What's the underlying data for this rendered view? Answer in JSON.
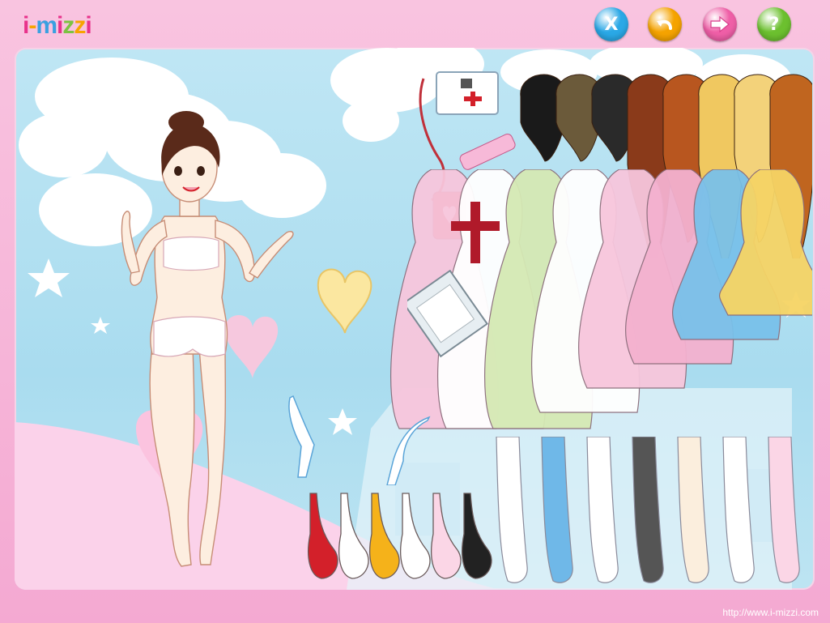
{
  "header": {
    "logo_text": "i-mizzi",
    "logo_letters": [
      "i",
      "-",
      "m",
      "i",
      "z",
      "z",
      "i"
    ],
    "logo_colors": [
      "#e8328b",
      "#f7a400",
      "#3aa0e0",
      "#e8328b",
      "#7cc242",
      "#f7a400",
      "#e8328b"
    ]
  },
  "toolbar": {
    "buttons": [
      {
        "id": "close",
        "glyph": "X",
        "icon": "x-icon",
        "color": "#2aa8e6"
      },
      {
        "id": "undo",
        "glyph": "↶",
        "icon": "undo-icon",
        "color": "#f5a300"
      },
      {
        "id": "next",
        "glyph": "⇨",
        "icon": "arrow-right-icon",
        "color": "#ef5fa7"
      },
      {
        "id": "help",
        "glyph": "?",
        "icon": "question-icon",
        "color": "#6cc02f"
      }
    ]
  },
  "footer": {
    "url": "http://www.i-mizzi.com"
  },
  "colors": {
    "sky": "#b8e3f3",
    "cloud": "#ffffff",
    "ground_pink": "#fbd2ea",
    "skin": "#fdeee0",
    "nurse_red": "#d3202a"
  },
  "wardrobe": {
    "hair_colors": [
      "#1a1a1a",
      "#6b5a3a",
      "#2a2a2a",
      "#8a3a1a",
      "#b8561f",
      "#f0c860",
      "#f3d27a",
      "#c0651f"
    ],
    "dress_colors": [
      "#f7c6dc",
      "#ffffff",
      "#d5e9b4",
      "#ffffff",
      "#f7c6dc",
      "#f4b1cf",
      "#79c1ea",
      "#f6d465"
    ],
    "shoe_colors": [
      "#d3202a",
      "#ffffff",
      "#f5b21a",
      "#ffffff",
      "#fbd6e6",
      "#222222"
    ],
    "sock_colors": [
      "#ffffff",
      "#6fb8e8",
      "#ffffff",
      "#555555",
      "#fbeedd",
      "#ffffff",
      "#fbd6e6"
    ]
  }
}
